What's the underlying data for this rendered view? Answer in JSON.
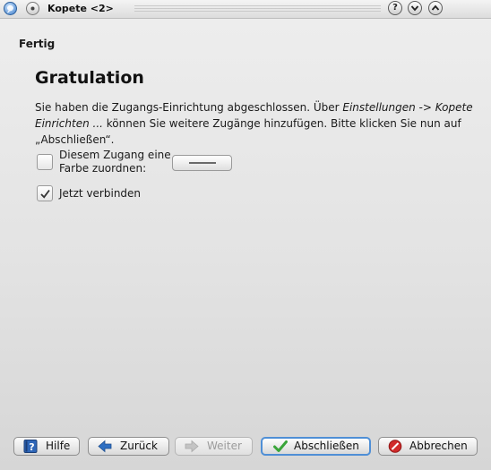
{
  "window": {
    "title": "Kopete <2>"
  },
  "wizard": {
    "header": "Fertig",
    "title": "Gratulation",
    "body": {
      "part1": "Sie haben die Zugangs-Einrichtung abgeschlossen. Über ",
      "italic1": "Einstellungen -> Kopete Einrichten ...",
      "part2": " können Sie weitere Zugänge hinzufügen. Bitte klicken Sie nun auf „Abschließen“."
    },
    "color_option": {
      "label_line1": "Diesem Zugang eine",
      "label_line2": "Farbe zuordnen:",
      "checked": false
    },
    "connect_option": {
      "label": "Jetzt verbinden",
      "checked": true
    }
  },
  "buttons": {
    "help": "Hilfe",
    "back": "Zurück",
    "next": "Weiter",
    "finish": "Abschließen",
    "cancel": "Abbrechen"
  },
  "icons": {
    "app": "kopete-app-icon",
    "menu": "window-menu-icon",
    "help": "help-book-icon",
    "back": "arrow-left-icon",
    "next": "arrow-right-icon",
    "finish": "checkmark-icon",
    "cancel": "cancel-icon"
  },
  "colors": {
    "finish_border": "#4f8fd6",
    "back_arrow": "#2f6fc2",
    "finish_check": "#3aa53a",
    "cancel_red": "#d12b2b"
  }
}
